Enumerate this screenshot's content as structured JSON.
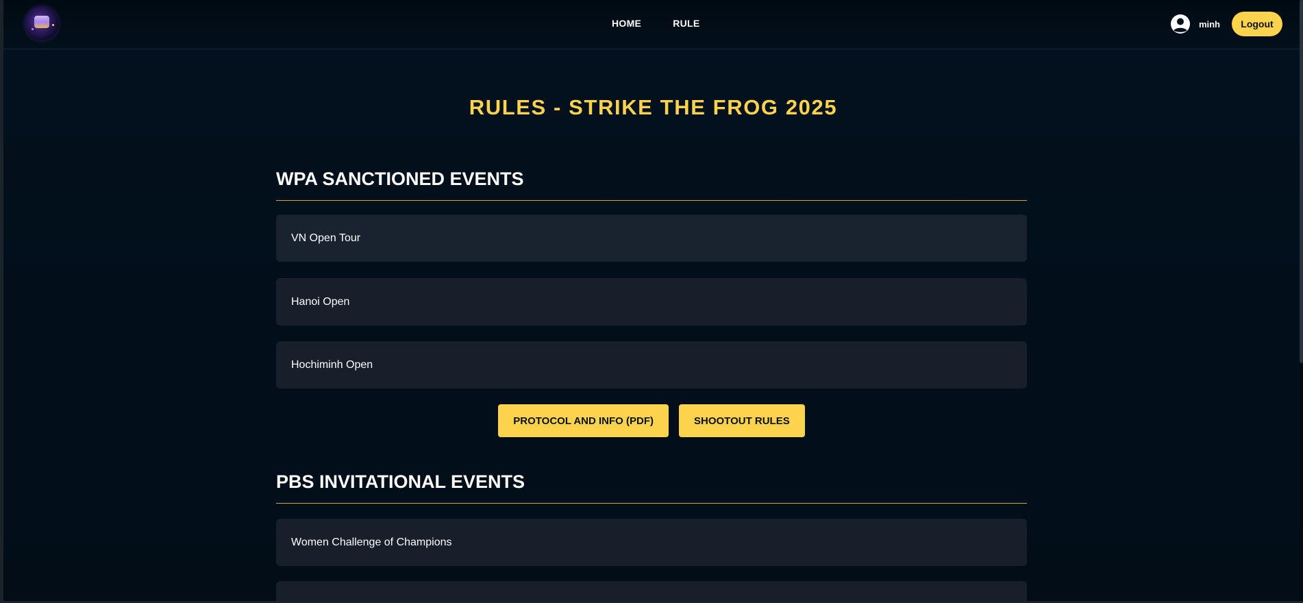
{
  "nav": {
    "links": [
      "HOME",
      "RULE"
    ],
    "username": "minh",
    "logout_label": "Logout"
  },
  "page": {
    "title": "RULES - STRIKE THE FROG 2025"
  },
  "sections": [
    {
      "title": "WPA SANCTIONED EVENTS",
      "events": [
        "VN Open Tour",
        "Hanoi Open",
        "Hochiminh Open"
      ],
      "buttons": [
        "PROTOCOL AND INFO (PDF)",
        "SHOOTOUT RULES"
      ]
    },
    {
      "title": "PBS INVITATIONAL EVENTS",
      "events": [
        "Women Challenge of Champions"
      ]
    }
  ],
  "colors": {
    "accent": "#fcd34d",
    "background": "#02101d",
    "card": "#19232f"
  }
}
